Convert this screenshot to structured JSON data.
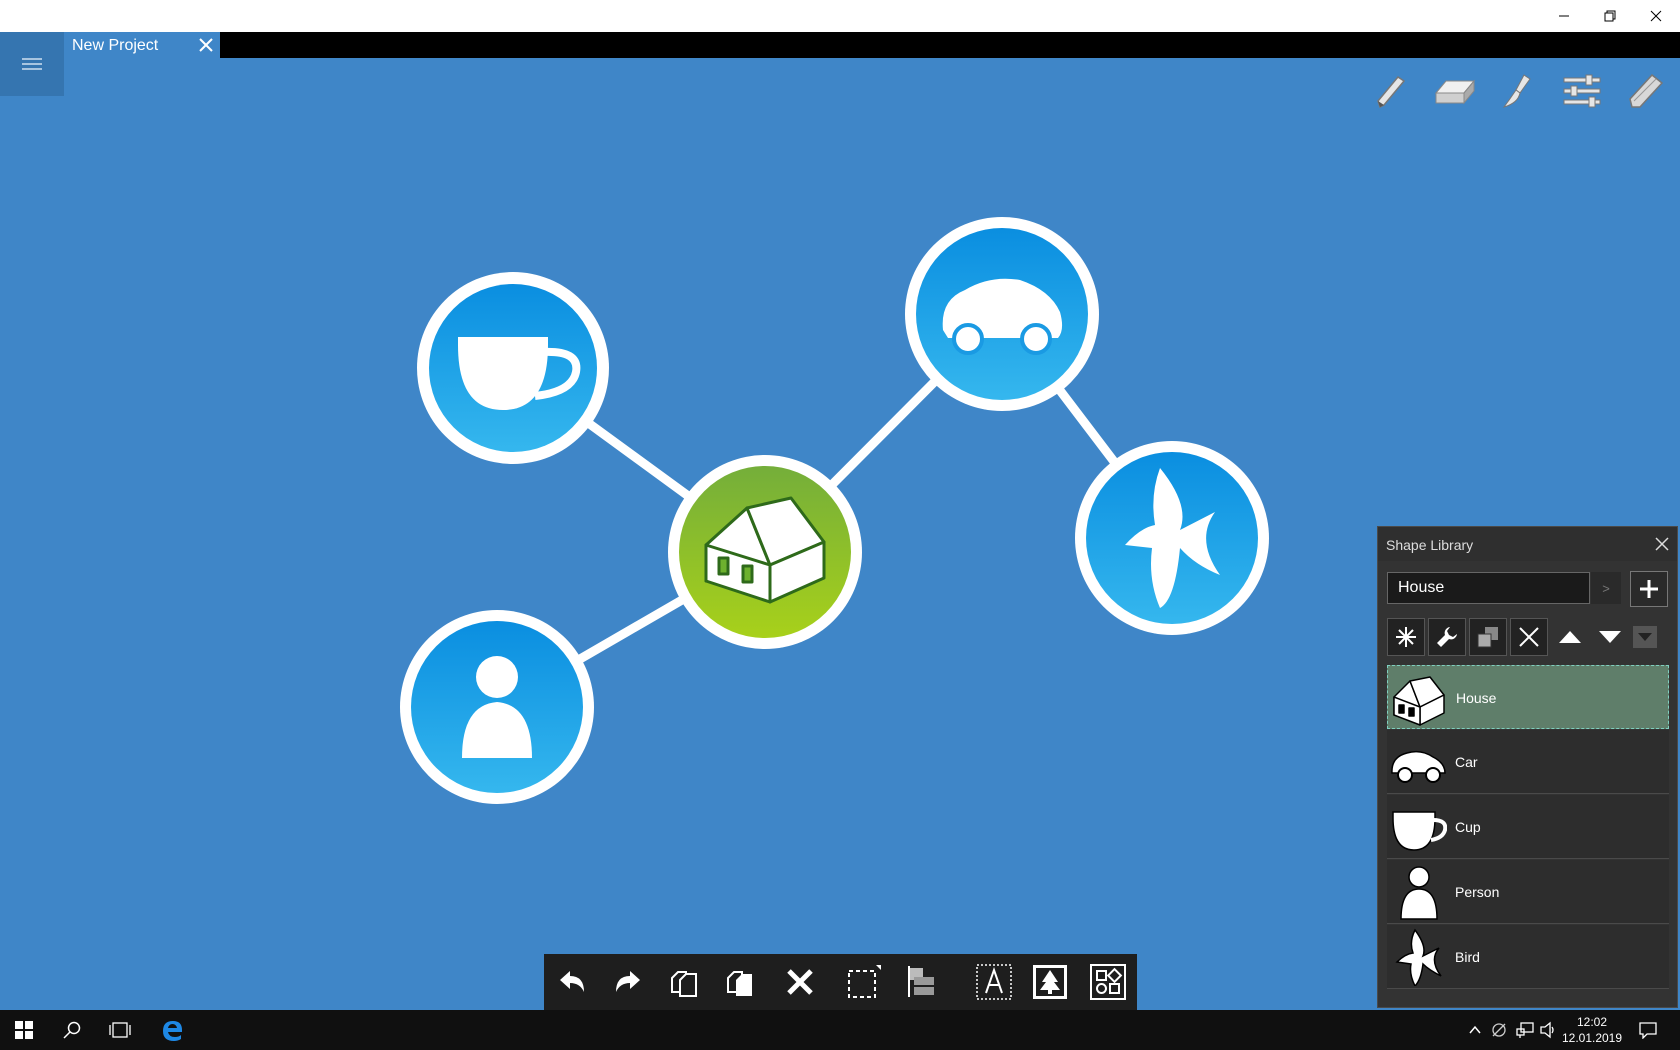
{
  "tab": {
    "title": "New Project"
  },
  "toolbar_icons": [
    "pencil-icon",
    "eraser-icon",
    "brush-icon",
    "settings-sliders-icon",
    "highlighter-icon"
  ],
  "diagram": {
    "nodes": [
      "house",
      "cup",
      "car",
      "person",
      "bird"
    ],
    "colors": {
      "background": "#3f86c8",
      "node_blue": "#1a9ae3",
      "node_green": "#8bc23a",
      "edge": "#ffffff"
    }
  },
  "bottom_toolbar_icons": [
    "undo-icon",
    "redo-icon",
    "copy-icon",
    "paste-icon",
    "delete-icon",
    "select-region-icon",
    "layers-icon",
    "text-icon",
    "insert-image-icon",
    "shapes-icon"
  ],
  "shape_library": {
    "title": "Shape Library",
    "search_value": "House",
    "go_label": ">",
    "items": [
      {
        "label": "House"
      },
      {
        "label": "Car"
      },
      {
        "label": "Cup"
      },
      {
        "label": "Person"
      },
      {
        "label": "Bird"
      }
    ]
  },
  "taskbar": {
    "time": "12:02",
    "date": "12.01.2019"
  }
}
